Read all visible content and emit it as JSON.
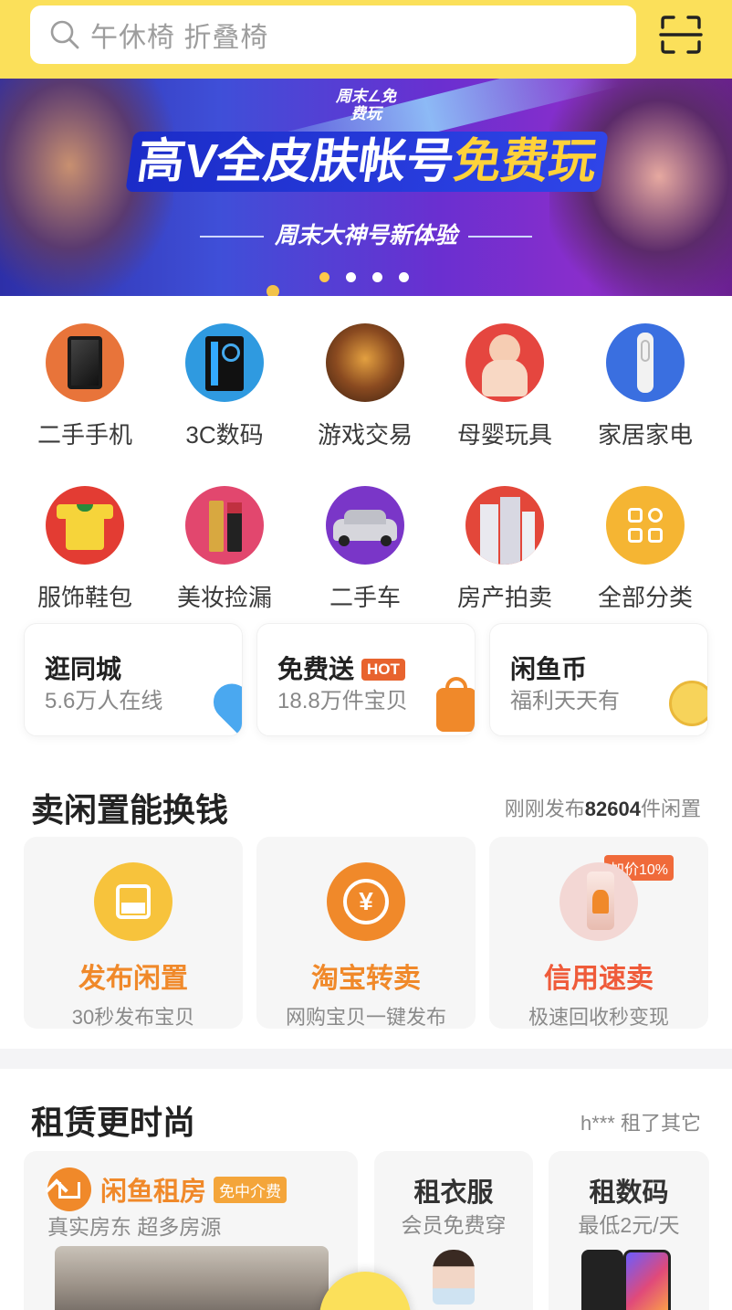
{
  "search": {
    "placeholder": "午休椅 折叠椅",
    "icon": "search-icon"
  },
  "header": {
    "scan_icon": "scan-icon"
  },
  "banner": {
    "badge": "周末∠免费玩",
    "headline_a": "高V全皮肤帐号",
    "headline_b": "免费玩",
    "subtitle": "周末大神号新体验",
    "dots": 4,
    "active_dot": 0
  },
  "categories": [
    {
      "label": "二手手机",
      "icon": "phone-icon"
    },
    {
      "label": "3C数码",
      "icon": "pc-case-icon"
    },
    {
      "label": "游戏交易",
      "icon": "game-icon"
    },
    {
      "label": "母婴玩具",
      "icon": "baby-icon"
    },
    {
      "label": "家居家电",
      "icon": "appliance-icon"
    },
    {
      "label": "服饰鞋包",
      "icon": "shirt-icon"
    },
    {
      "label": "美妆捡漏",
      "icon": "cosmetics-icon"
    },
    {
      "label": "二手车",
      "icon": "car-icon"
    },
    {
      "label": "房产拍卖",
      "icon": "building-icon"
    },
    {
      "label": "全部分类",
      "icon": "grid-icon"
    }
  ],
  "quick": [
    {
      "title": "逛同城",
      "subtitle": "5.6万人在线",
      "icon": "location-pin-icon"
    },
    {
      "title": "免费送",
      "badge": "HOT",
      "subtitle": "18.8万件宝贝",
      "icon": "gift-bag-icon"
    },
    {
      "title": "闲鱼币",
      "subtitle": "福利天天有",
      "icon": "fish-coin-icon"
    }
  ],
  "sell": {
    "title": "卖闲置能换钱",
    "meta_prefix": "刚刚发布",
    "meta_count": "82604",
    "meta_suffix": "件闲置",
    "cards": [
      {
        "name": "发布闲置",
        "desc": "30秒发布宝贝",
        "icon": "publish-icon"
      },
      {
        "name": "淘宝转卖",
        "desc": "网购宝贝一键发布",
        "icon": "resell-yuan-icon"
      },
      {
        "name": "信用速卖",
        "desc": "极速回收秒变现",
        "badge": "加价10%",
        "icon": "phone-product-icon"
      }
    ]
  },
  "rent": {
    "title": "租赁更时尚",
    "meta": "h*** 租了其它",
    "house": {
      "title": "闲鱼租房",
      "badge": "免中介费",
      "subtitle": "真实房东 超多房源"
    },
    "cards": [
      {
        "title": "租衣服",
        "subtitle": "会员免费穿"
      },
      {
        "title": "租数码",
        "subtitle": "最低2元/天"
      }
    ]
  },
  "colors": {
    "header_yellow": "#fbe05a",
    "accent_orange": "#f0892a",
    "hot_red": "#e8632e"
  }
}
